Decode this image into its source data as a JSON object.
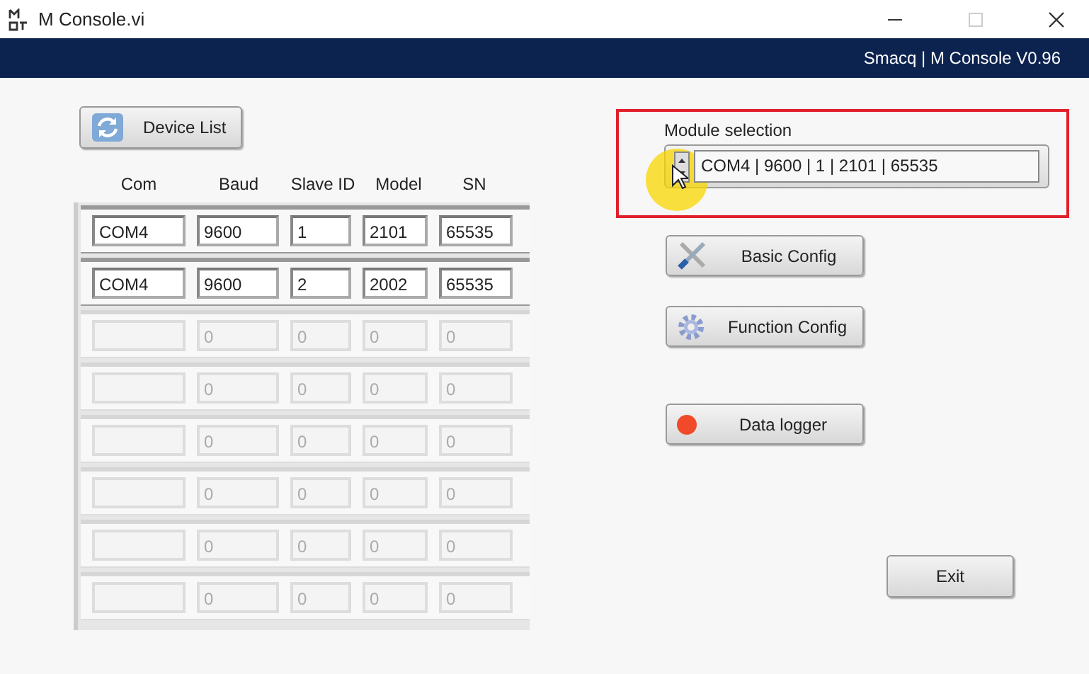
{
  "window": {
    "title": "M Console.vi"
  },
  "banner": {
    "text": "Smacq | M Console V0.96"
  },
  "device_list_button": "Device List",
  "table": {
    "columns": [
      "Com",
      "Baud",
      "Slave ID",
      "Model",
      "SN"
    ],
    "rows": [
      {
        "disabled": false,
        "com": "COM4",
        "baud": "9600",
        "slave_id": "1",
        "model": "2101",
        "sn": "65535"
      },
      {
        "disabled": false,
        "com": "COM4",
        "baud": "9600",
        "slave_id": "2",
        "model": "2002",
        "sn": "65535"
      },
      {
        "disabled": true,
        "baud": "0",
        "slave_id": "0",
        "model": "0",
        "sn": "0"
      },
      {
        "disabled": true,
        "baud": "0",
        "slave_id": "0",
        "model": "0",
        "sn": "0"
      },
      {
        "disabled": true,
        "baud": "0",
        "slave_id": "0",
        "model": "0",
        "sn": "0"
      },
      {
        "disabled": true,
        "baud": "0",
        "slave_id": "0",
        "model": "0",
        "sn": "0"
      },
      {
        "disabled": true,
        "baud": "0",
        "slave_id": "0",
        "model": "0",
        "sn": "0"
      },
      {
        "disabled": true,
        "baud": "0",
        "slave_id": "0",
        "model": "0",
        "sn": "0"
      }
    ]
  },
  "module_selection": {
    "label": "Module selection",
    "value": "COM4 | 9600 | 1 | 2101 | 65535"
  },
  "buttons": [
    {
      "kind": "wrench",
      "label": "Basic Config"
    },
    {
      "kind": "gear",
      "label": "Function Config"
    },
    {
      "kind": "dot",
      "label": "Data logger"
    }
  ],
  "exit_button": "Exit"
}
